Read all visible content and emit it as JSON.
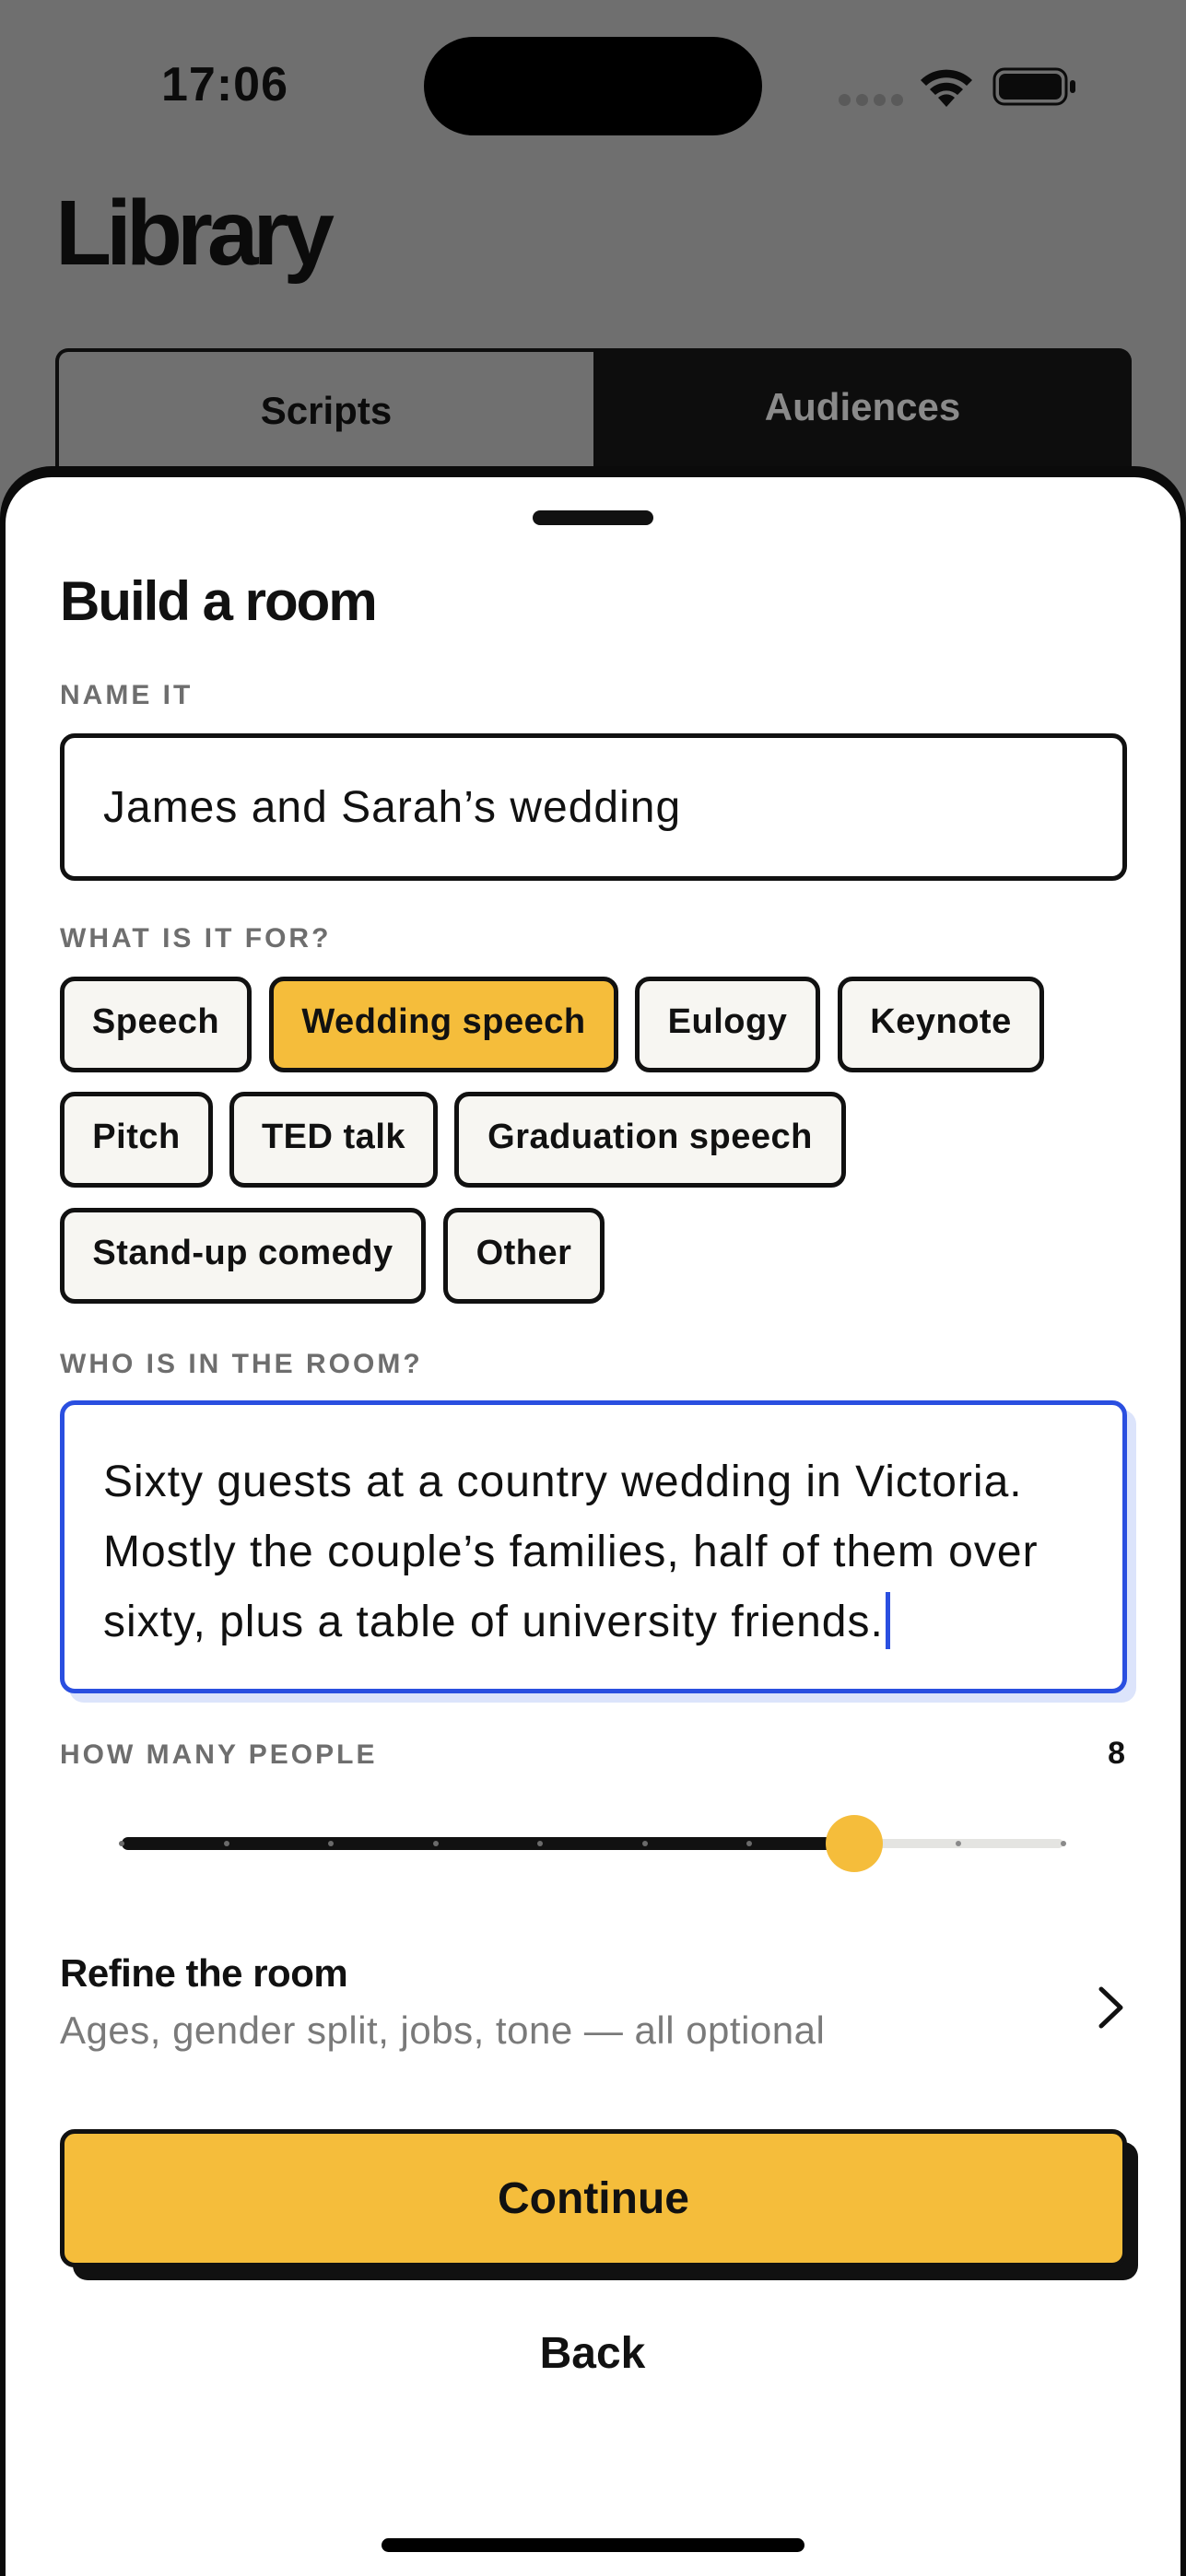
{
  "status_bar": {
    "time": "17:06"
  },
  "background": {
    "title": "Library",
    "tabs": [
      {
        "label": "Scripts",
        "active": true
      },
      {
        "label": "Audiences",
        "active": false
      }
    ]
  },
  "sheet": {
    "title": "Build a room",
    "name_label": "NAME IT",
    "name_value": "James and Sarah’s wedding",
    "purpose_label": "WHAT IS IT FOR?",
    "purpose_options": [
      {
        "label": "Speech",
        "selected": false
      },
      {
        "label": "Wedding speech",
        "selected": true
      },
      {
        "label": "Eulogy",
        "selected": false
      },
      {
        "label": "Keynote",
        "selected": false
      },
      {
        "label": "Pitch",
        "selected": false
      },
      {
        "label": "TED talk",
        "selected": false
      },
      {
        "label": "Graduation speech",
        "selected": false
      },
      {
        "label": "Stand-up comedy",
        "selected": false
      },
      {
        "label": "Other",
        "selected": false
      }
    ],
    "room_label": "WHO IS IN THE ROOM?",
    "room_text": "Sixty guests at a country wedding in Victoria. Mostly the couple’s families, half of them over sixty, plus a table of university friends.",
    "people_label": "HOW MANY PEOPLE",
    "people_count": "8",
    "slider": {
      "min": 1,
      "max": 10,
      "value": 8
    },
    "refine_title": "Refine the room",
    "refine_subtitle": "Ages, gender split, jobs, tone — all optional",
    "continue_label": "Continue",
    "back_label": "Back"
  },
  "colors": {
    "accent": "#f5bd3b",
    "focus": "#2a4fe0",
    "ink": "#111111"
  }
}
